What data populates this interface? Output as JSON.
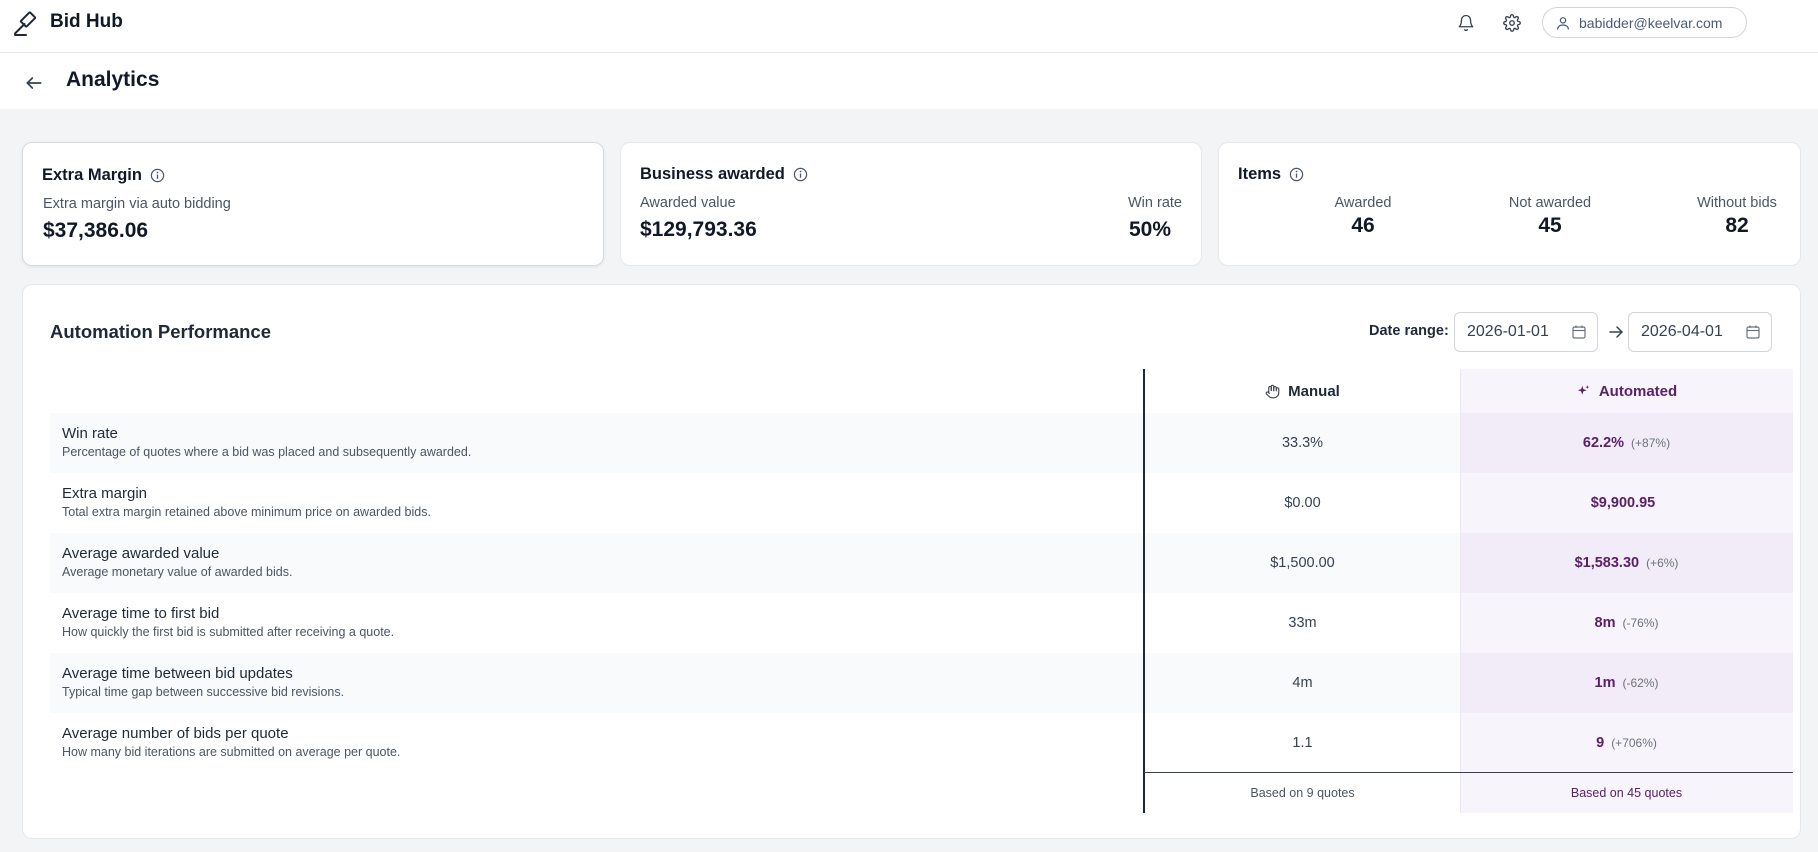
{
  "app": {
    "brand": "Bid Hub",
    "user_email": "babidder@keelvar.com"
  },
  "page": {
    "title": "Analytics"
  },
  "cards": {
    "extra_margin": {
      "title": "Extra Margin",
      "label": "Extra margin via auto bidding",
      "value": "$37,386.06"
    },
    "business_awarded": {
      "title": "Business awarded",
      "awarded_label": "Awarded value",
      "awarded_value": "$129,793.36",
      "winrate_label": "Win rate",
      "winrate_value": "50%"
    },
    "items": {
      "title": "Items",
      "cols": [
        {
          "label": "Awarded",
          "value": "46"
        },
        {
          "label": "Not awarded",
          "value": "45"
        },
        {
          "label": "Without bids",
          "value": "82"
        }
      ]
    }
  },
  "performance": {
    "title": "Automation Performance",
    "date_range_label": "Date range:",
    "date_from": "2026-01-01",
    "date_to": "2026-04-01",
    "columns": {
      "manual": "Manual",
      "automated": "Automated"
    },
    "rows": [
      {
        "name": "Win rate",
        "desc": "Percentage of quotes where a bid was placed and subsequently awarded.",
        "manual": "33.3%",
        "auto": "62.2%",
        "delta": "(+87%)"
      },
      {
        "name": "Extra margin",
        "desc": "Total extra margin retained above minimum price on awarded bids.",
        "manual": "$0.00",
        "auto": "$9,900.95",
        "delta": ""
      },
      {
        "name": "Average awarded value",
        "desc": "Average monetary value of awarded bids.",
        "manual": "$1,500.00",
        "auto": "$1,583.30",
        "delta": "(+6%)"
      },
      {
        "name": "Average time to first bid",
        "desc": "How quickly the first bid is submitted after receiving a quote.",
        "manual": "33m",
        "auto": "8m",
        "delta": "(-76%)"
      },
      {
        "name": "Average time between bid updates",
        "desc": "Typical time gap between successive bid revisions.",
        "manual": "4m",
        "auto": "1m",
        "delta": "(-62%)"
      },
      {
        "name": "Average number of bids per quote",
        "desc": "How many bid iterations are submitted on average per quote.",
        "manual": "1.1",
        "auto": "9",
        "delta": "(+706%)"
      }
    ],
    "footer": {
      "manual": "Based on 9 quotes",
      "automated": "Based on 45 quotes"
    }
  },
  "colors": {
    "accent": "#5b2168",
    "automated_bg": "#f7f4fb"
  }
}
